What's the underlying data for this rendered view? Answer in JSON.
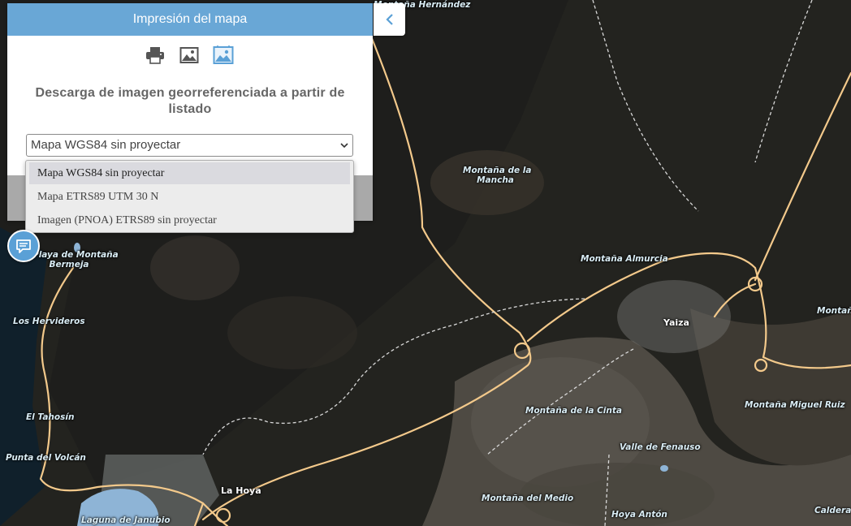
{
  "panel": {
    "title": "Impresión del mapa",
    "description": "Descarga de imagen georreferenciada a partir de listado",
    "tabs": [
      {
        "icon": "printer-icon"
      },
      {
        "icon": "image-icon"
      },
      {
        "icon": "georeferenced-image-icon",
        "active": true
      }
    ],
    "select": {
      "value": "Mapa WGS84 sin proyectar",
      "options": [
        "Mapa WGS84 sin proyectar",
        "Mapa ETRS89 UTM 30 N",
        "Imagen (PNOA) ETRS89 sin proyectar"
      ]
    },
    "header_color": "#69a7d6"
  },
  "collapse_icon": "chevron-left-icon",
  "chat_icon": "chat-bubble-icon",
  "map": {
    "labels": {
      "montana_hernandez": "Montaña Hernández",
      "montana_mancha": "Montaña de la\nMancha",
      "playa_bermeja": "Playa de Montaña\nBermeja",
      "montana_almurcia": "Montaña Almurcia",
      "yaiza": "Yaiza",
      "montana_right": "Montaña",
      "los_hervideros": "Los Hervideros",
      "montana_cinta": "Montaña de la Cinta",
      "montana_miguel_ruiz": "Montaña Miguel Ruiz",
      "el_tahosin": "El Tahosín",
      "valle_fenauso": "Valle de Fenauso",
      "punta_volcan": "Punta del Volcán",
      "la_hoya": "La Hoya",
      "montana_medio": "Montaña del Medio",
      "hoya_anton": "Hoya Antón",
      "caldera": "Caldera E",
      "laguna_janubio": "Laguna de Janubio"
    },
    "road_color": "#f3c98b"
  }
}
